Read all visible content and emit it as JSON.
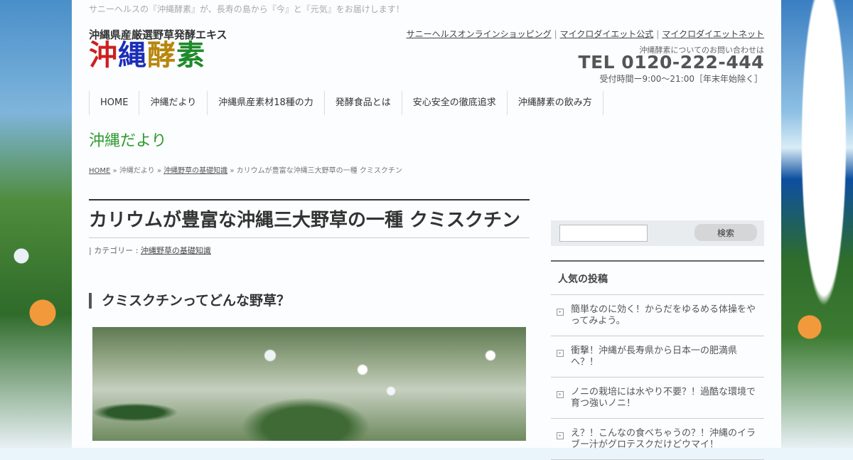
{
  "tagline": "サニーヘルスの『沖縄酵素』が、長寿の島から『今』と『元気』をお届けします！",
  "logo": {
    "subtitle": "沖縄県産厳選野草発酵エキス",
    "chars": [
      "沖",
      "縄",
      "酵",
      "素"
    ]
  },
  "top_links": [
    "サニーヘルスオンラインショッピング",
    "マイクロダイエット公式",
    "マイクロダイエットネット"
  ],
  "contact": {
    "label": "沖縄酵素についてのお問い合わせは",
    "tel": "TEL 0120-222-444",
    "hours": "受付時間ー9:00〜21:00［年末年始除く］"
  },
  "nav": [
    "HOME",
    "沖縄だより",
    "沖縄県産素材18種の力",
    "発酵食品とは",
    "安心安全の徹底追求",
    "沖縄酵素の飲み方"
  ],
  "section_title": "沖縄だより",
  "breadcrumb": {
    "home": "HOME",
    "sep": "»",
    "level1": "沖縄だより",
    "level2": "沖縄野草の基礎知識",
    "current": "カリウムが豊富な沖縄三大野草の一種 クミスクチン"
  },
  "article": {
    "title": "カリウムが豊富な沖縄三大野草の一種 クミスクチン",
    "category_label": "| カテゴリー :",
    "category": "沖縄野草の基礎知識",
    "h2": "クミスクチンってどんな野草？"
  },
  "sidebar": {
    "search_button": "検索",
    "search_value": "",
    "popular_title": "人気の投稿",
    "popular_items": [
      "簡単なのに効く！からだをゆるめる体操をやってみよう。",
      "衝撃！沖縄が長寿県から日本一の肥満県へ？！",
      "ノニの栽培には水やり不要？！過酷な環境で育つ強いノニ！",
      "え？！こんなの食べちゃうの？！沖縄のイラブー汁がグロテスクだけどウマイ！"
    ]
  }
}
